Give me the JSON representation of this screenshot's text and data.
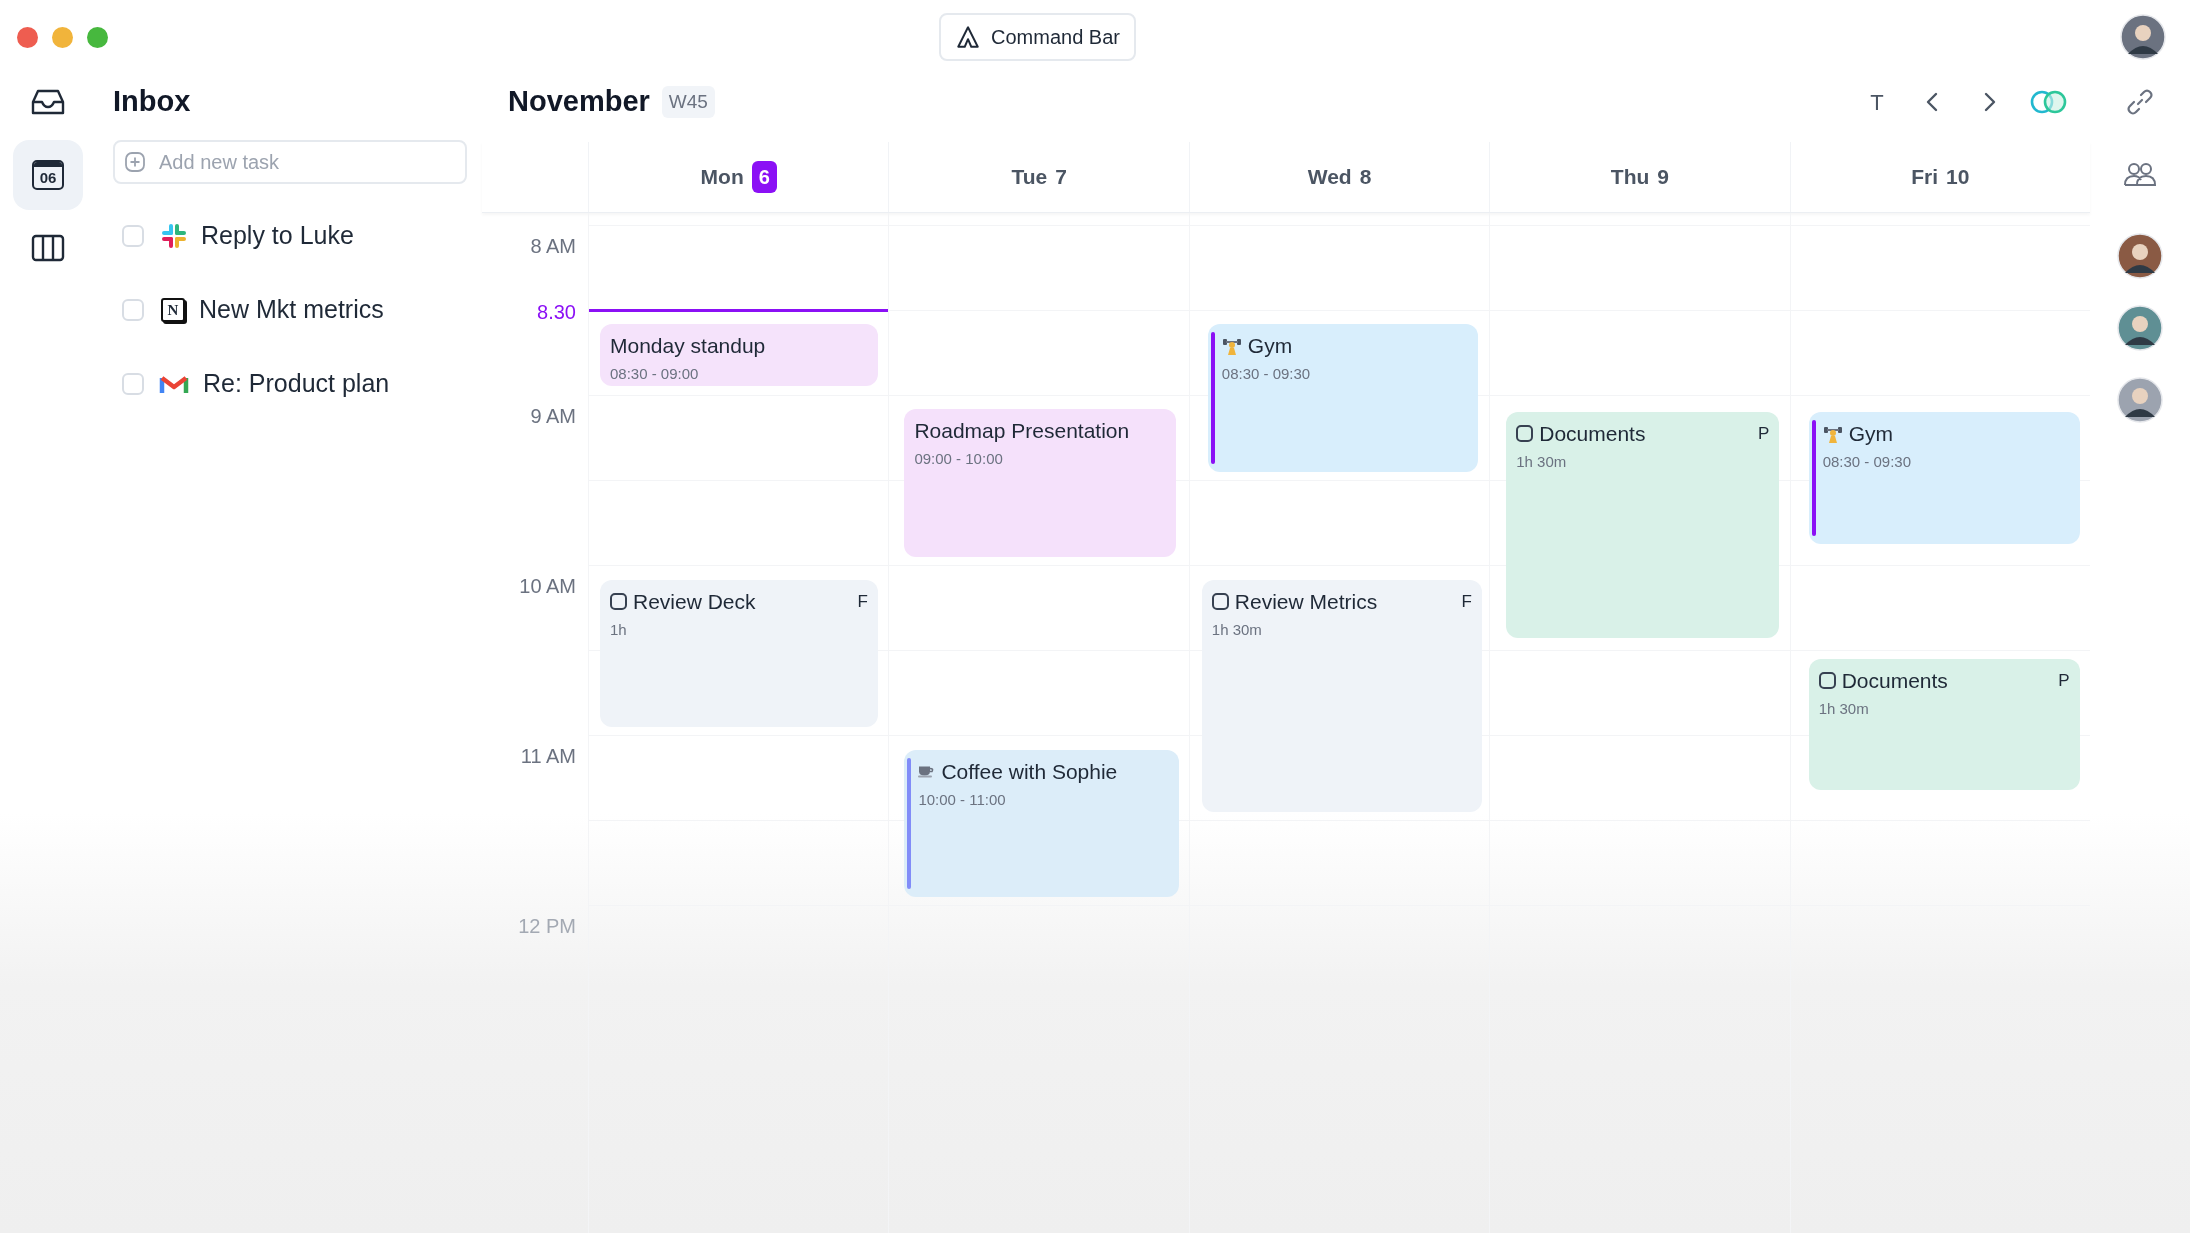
{
  "command_bar": {
    "label": "Command Bar"
  },
  "rail": [
    {
      "selected": false
    },
    {
      "label": "06",
      "selected": true
    },
    {
      "selected": false
    }
  ],
  "inbox": {
    "title": "Inbox",
    "new_task": {
      "placeholder": "Add new task"
    },
    "tasks": [
      {
        "label": "Reply to Luke",
        "checked": false
      },
      {
        "label": "New Mkt metrics",
        "checked": false,
        "icon_text": "N"
      },
      {
        "label": "Re: Product plan",
        "checked": false
      }
    ]
  },
  "calendar": {
    "month": "November",
    "week": "W45",
    "today_button": "T",
    "now": "8.30",
    "hours": [
      "8 AM",
      "9 AM",
      "10 AM",
      "11 AM",
      "12 PM"
    ],
    "days": [
      {
        "name": "Mon",
        "date": "6",
        "today": true,
        "events": [
          {
            "kind": "meeting",
            "title": "Monday standup",
            "time": "08:30 - 09:00",
            "color": "#f5e3fb"
          },
          {
            "kind": "task",
            "title": "Review Deck",
            "time": "1h",
            "tag": "F",
            "checked": false,
            "color": "#eff3f8"
          }
        ]
      },
      {
        "name": "Tue",
        "date": "7",
        "today": false,
        "events": [
          {
            "kind": "meeting",
            "title": "Roadmap Presentation",
            "time": "09:00 - 10:00",
            "color": "#f5e1fb"
          },
          {
            "kind": "social",
            "title": "Coffee with Sophie",
            "time": "10:00 - 11:00",
            "color": "#dcedf9"
          }
        ]
      },
      {
        "name": "Wed",
        "date": "8",
        "today": false,
        "events": [
          {
            "kind": "workout",
            "title": "Gym",
            "time": "08:30 - 09:30",
            "color": "#d8eefc"
          },
          {
            "kind": "task",
            "title": "Review Metrics",
            "time": "1h 30m",
            "tag": "F",
            "checked": false,
            "color": "#eff3f8"
          }
        ]
      },
      {
        "name": "Thu",
        "date": "9",
        "today": false,
        "events": [
          {
            "kind": "task",
            "title": "Documents",
            "time": "1h 30m",
            "tag": "P",
            "checked": false,
            "color": "#d9f1e8"
          }
        ]
      },
      {
        "name": "Fri",
        "date": "10",
        "today": false,
        "events": [
          {
            "kind": "workout",
            "title": "Gym",
            "time": "08:30 - 09:30",
            "color": "#d8eefc"
          },
          {
            "kind": "task",
            "title": "Documents",
            "time": "1h 30m",
            "tag": "P",
            "checked": false,
            "color": "#d9f1e8"
          }
        ]
      }
    ]
  }
}
